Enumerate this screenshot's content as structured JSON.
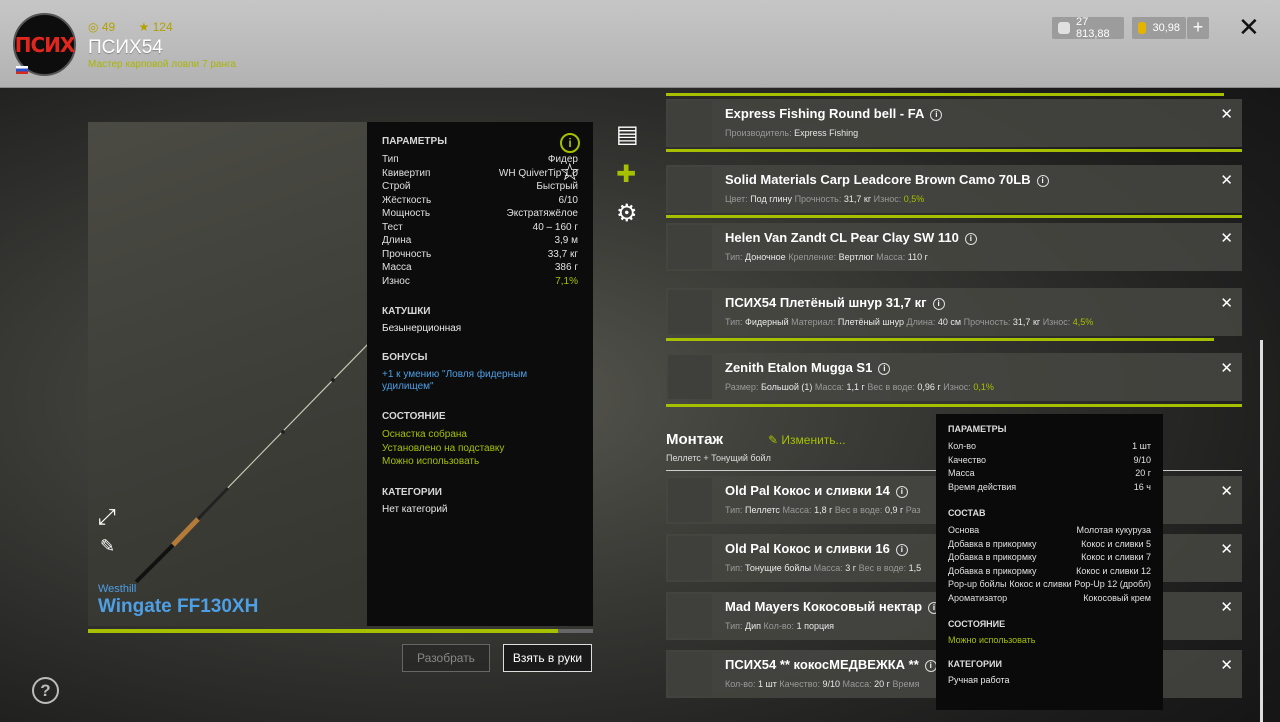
{
  "header": {
    "avatar_text": "ПСИХ",
    "coins": "49",
    "stars": "124",
    "username": "ПСИХ54",
    "rank": "Мастер карповой ловли 7 ранга",
    "silver": "27 813,88",
    "gold": "30,98",
    "plus": "+",
    "close": "✕"
  },
  "rod": {
    "brand": "Westhill",
    "name": "Wingate FF130XH",
    "progress_fraction": 0.93
  },
  "params": {
    "title": "ПАРАМЕТРЫ",
    "rows": [
      {
        "k": "Тип",
        "v": "Фидер"
      },
      {
        "k": "Квивертип",
        "v": "WH QuiverTip 1.0"
      },
      {
        "k": "Строй",
        "v": "Быстрый"
      },
      {
        "k": "Жёсткость",
        "v": "6/10"
      },
      {
        "k": "Мощность",
        "v": "Экстратяжёлое"
      },
      {
        "k": "Тест",
        "v": "40 – 160 г"
      },
      {
        "k": "Длина",
        "v": "3,9 м"
      },
      {
        "k": "Прочность",
        "v": "33,7 кг"
      },
      {
        "k": "Масса",
        "v": "386 г"
      },
      {
        "k": "Износ",
        "v": "7,1%"
      }
    ],
    "reels_title": "КАТУШКИ",
    "reels_value": "Безынерционная",
    "bonus_title": "БОНУСЫ",
    "bonus_value": "+1 к умению \"Ловля фидерным удилищем\"",
    "state_title": "СОСТОЯНИЕ",
    "state_values": [
      "Оснастка собрана",
      "Установлено на подставку",
      "Можно использовать"
    ],
    "cat_title": "КАТЕГОРИИ",
    "cat_value": "Нет категорий"
  },
  "buttons": {
    "disassemble": "Разобрать",
    "take": "Взять в руки"
  },
  "items": [
    {
      "name": "Express Fishing Round bell - FA",
      "desc": [
        [
          "Производитель:",
          "Express Fishing"
        ]
      ]
    },
    {
      "name": "Solid Materials Carp Leadcore Brown Camo 70LB",
      "desc": [
        [
          "Цвет:",
          "Под глину"
        ],
        [
          "Прочность:",
          "31,7 кг"
        ],
        [
          "Износ:",
          "0,5%"
        ]
      ]
    },
    {
      "name": "Helen Van Zandt CL Pear Clay SW 110",
      "desc": [
        [
          "Тип:",
          "Доночное"
        ],
        [
          "Крепление:",
          "Вертлюг"
        ],
        [
          "Масса:",
          "110 г"
        ]
      ]
    },
    {
      "name": "ПСИХ54 Плетёный шнур 31,7 кг",
      "desc": [
        [
          "Тип:",
          "Фидерный"
        ],
        [
          "Материал:",
          "Плетёный шнур"
        ],
        [
          "Длина:",
          "40 см"
        ],
        [
          "Прочность:",
          "31,7 кг"
        ],
        [
          "Износ:",
          "4,5%"
        ]
      ]
    },
    {
      "name": "Zenith Etalon Mugga S1",
      "desc": [
        [
          "Размер:",
          "Большой (1)"
        ],
        [
          "Масса:",
          "1,1 г"
        ],
        [
          "Вес в воде:",
          "0,96 г"
        ],
        [
          "Износ:",
          "0,1%"
        ]
      ]
    }
  ],
  "montage": {
    "title": "Монтаж",
    "subtitle": "Пеллетс + Тонущий бойл",
    "change_label": "Изменить...",
    "items": [
      {
        "name": "Old Pal Кокос и сливки 14",
        "desc": [
          [
            "Тип:",
            "Пеллетс"
          ],
          [
            "Масса:",
            "1,8 г"
          ],
          [
            "Вес в воде:",
            "0,9 г"
          ],
          [
            "Раз",
            ""
          ]
        ]
      },
      {
        "name": "Old Pal Кокос и сливки 16",
        "desc": [
          [
            "Тип:",
            "Тонущие бойлы"
          ],
          [
            "Масса:",
            "3 г"
          ],
          [
            "Вес в воде:",
            "1,5"
          ]
        ]
      },
      {
        "name": "Mad Mayers Кокосовый нектар",
        "desc": [
          [
            "Тип:",
            "Дип"
          ],
          [
            "Кол-во:",
            "1 порция"
          ]
        ]
      },
      {
        "name": "ПСИХ54 ** кокосМЕДВЕЖКА **",
        "desc": [
          [
            "Кол-во:",
            "1 шт"
          ],
          [
            "Качество:",
            "9/10"
          ],
          [
            "Масса:",
            "20 г"
          ],
          [
            "Время",
            ""
          ]
        ]
      }
    ]
  },
  "tooltip": {
    "params_title": "ПАРАМЕТРЫ",
    "params": [
      {
        "k": "Кол-во",
        "v": "1 шт"
      },
      {
        "k": "Качество",
        "v": "9/10"
      },
      {
        "k": "Масса",
        "v": "20 г"
      },
      {
        "k": "Время действия",
        "v": "16 ч"
      }
    ],
    "comp_title": "СОСТАВ",
    "comp": [
      {
        "k": "Основа",
        "v": "Молотая кукуруза"
      },
      {
        "k": "Добавка в прикормку",
        "v": "Кокос и сливки 5"
      },
      {
        "k": "Добавка в прикормку",
        "v": "Кокос и сливки 7"
      },
      {
        "k": "Добавка в прикормку",
        "v": "Кокос и сливки 12"
      },
      {
        "k": "Pop-up бойлы",
        "v": "Кокос и сливки Pop-Up 12 (дробл)"
      },
      {
        "k": "Ароматизатор",
        "v": "Кокосовый крем"
      }
    ],
    "state_title": "СОСТОЯНИЕ",
    "state_value": "Можно использовать",
    "cat_title": "КАТЕГОРИИ",
    "cat_value": "Ручная работа"
  },
  "colors": {
    "accent": "#a6c000",
    "link": "#4d9fe6",
    "logo": "#e2261d"
  }
}
